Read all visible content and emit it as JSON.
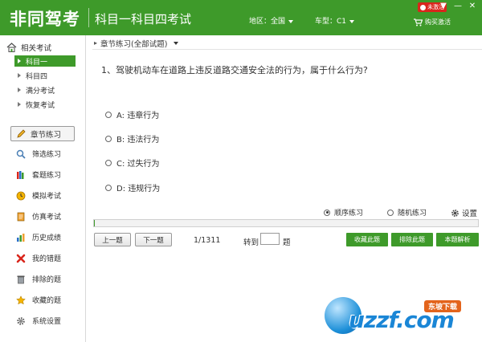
{
  "header": {
    "app_title": "非同驾考",
    "subtitle": "科目一科目四考试",
    "region": "地区：全国",
    "car_type": "车型：C1",
    "badge": "未激活",
    "buy_label": "购买激活",
    "win_menu": "▼",
    "win_min": "—",
    "win_close": "✕"
  },
  "sidebar": {
    "section_title": "相关考试",
    "tree": [
      "科目一",
      "科目四",
      "满分考试",
      "恢复考试"
    ],
    "active_tree_index": 0,
    "chapter_button": "章节练习",
    "nav": [
      {
        "label": "筛选练习",
        "icon": "magnifier-icon"
      },
      {
        "label": "套题练习",
        "icon": "books-icon"
      },
      {
        "label": "模拟考试",
        "icon": "clock-icon"
      },
      {
        "label": "仿真考试",
        "icon": "notepad-icon"
      },
      {
        "label": "历史成绩",
        "icon": "bar-chart-icon"
      },
      {
        "label": "我的错题",
        "icon": "red-x-icon"
      },
      {
        "label": "排除的题",
        "icon": "trash-icon"
      },
      {
        "label": "收藏的题",
        "icon": "star-icon"
      },
      {
        "label": "系统设置",
        "icon": "gear-icon"
      }
    ]
  },
  "main": {
    "breadcrumb": "章节练习(全部试题)",
    "question": "1、驾驶机动车在道路上违反道路交通安全法的行为，属于什么行为?",
    "options": [
      "A: 违章行为",
      "B: 违法行为",
      "C: 过失行为",
      "D: 违规行为"
    ],
    "mode_sequential": "顺序练习",
    "mode_random": "随机练习",
    "mode_selected": "sequential",
    "settings_label": "设置",
    "progress_fraction": 0.0008,
    "prev_button": "上一题",
    "next_button": "下一题",
    "counter": "1/1311",
    "goto_label": "转到",
    "goto_value": "",
    "goto_unit": "题",
    "favorite_button": "收藏此题",
    "exclude_button": "排除此题",
    "explain_button": "本题解析"
  },
  "watermark": {
    "text": "uzzf.com",
    "tag": "东坡下载"
  },
  "colors": {
    "brand_green": "#3e9a2a",
    "badge_red": "#d9261c",
    "watermark_blue": "#1a86d6",
    "watermark_orange": "#e3641c"
  }
}
